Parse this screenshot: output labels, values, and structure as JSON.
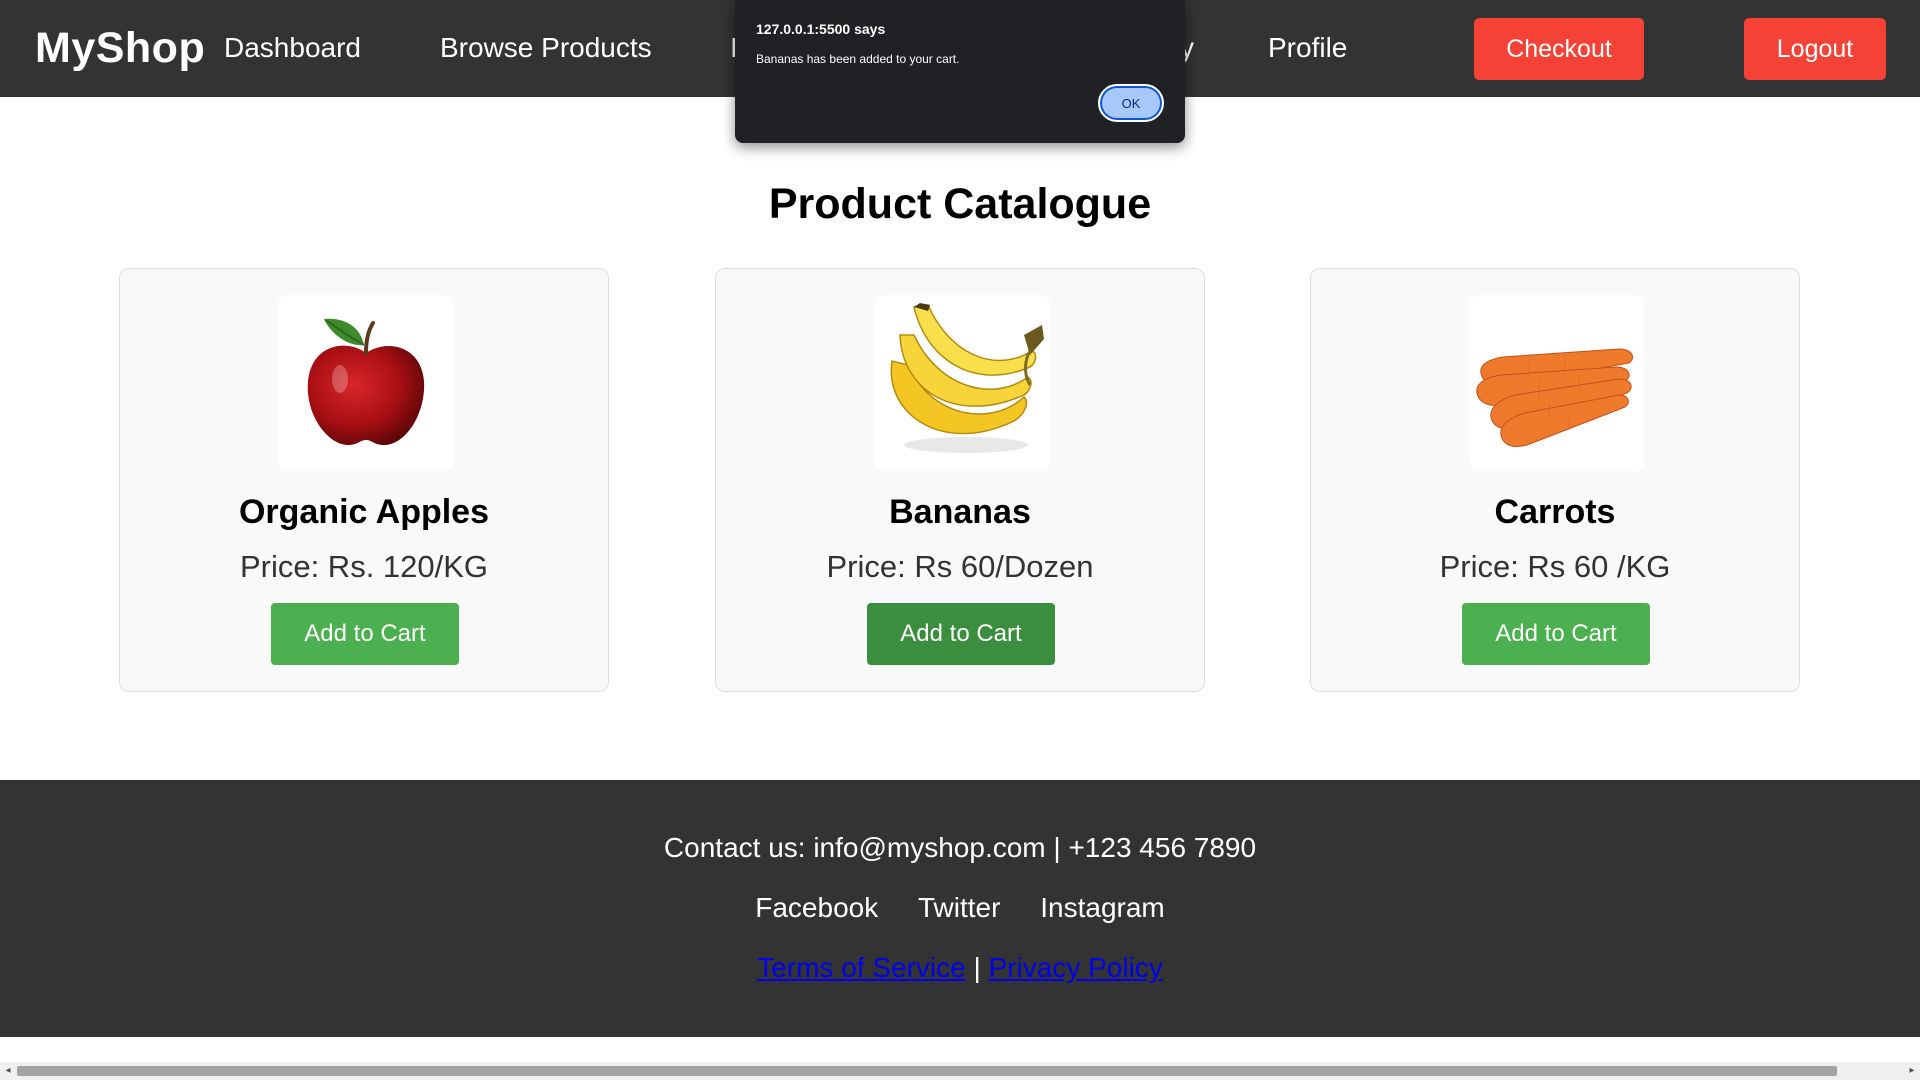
{
  "header": {
    "brand": "MyShop",
    "nav": {
      "dashboard": "Dashboard",
      "browse": "Browse Products",
      "partial_left": "I",
      "partial_right": "y",
      "profile": "Profile"
    },
    "checkout_label": "Checkout",
    "logout_label": "Logout"
  },
  "main": {
    "title": "Product Catalogue",
    "products": [
      {
        "name": "Organic Apples",
        "price": "Price: Rs. 120/KG",
        "button": "Add to Cart",
        "image": "apple-image"
      },
      {
        "name": "Bananas",
        "price": "Price: Rs 60/Dozen",
        "button": "Add to Cart",
        "image": "banana-image"
      },
      {
        "name": "Carrots",
        "price": "Price: Rs 60 /KG",
        "button": "Add to Cart",
        "image": "carrot-image"
      }
    ]
  },
  "footer": {
    "contact": "Contact us: info@myshop.com | +123 456 7890",
    "social": {
      "facebook": "Facebook",
      "twitter": "Twitter",
      "instagram": "Instagram"
    },
    "terms": "Terms of Service",
    "separator": "|",
    "privacy": "Privacy Policy"
  },
  "dialog": {
    "title": "127.0.0.1:5500 says",
    "message": "Bananas has been added to your cart.",
    "ok_label": "OK"
  },
  "colors": {
    "header_bg": "#333333",
    "danger_button": "#f44336",
    "cart_button": "#4caf50",
    "cart_button_active": "#3a8e3d",
    "dialog_bg": "#202124",
    "dialog_ok": "#a8c7fa"
  }
}
